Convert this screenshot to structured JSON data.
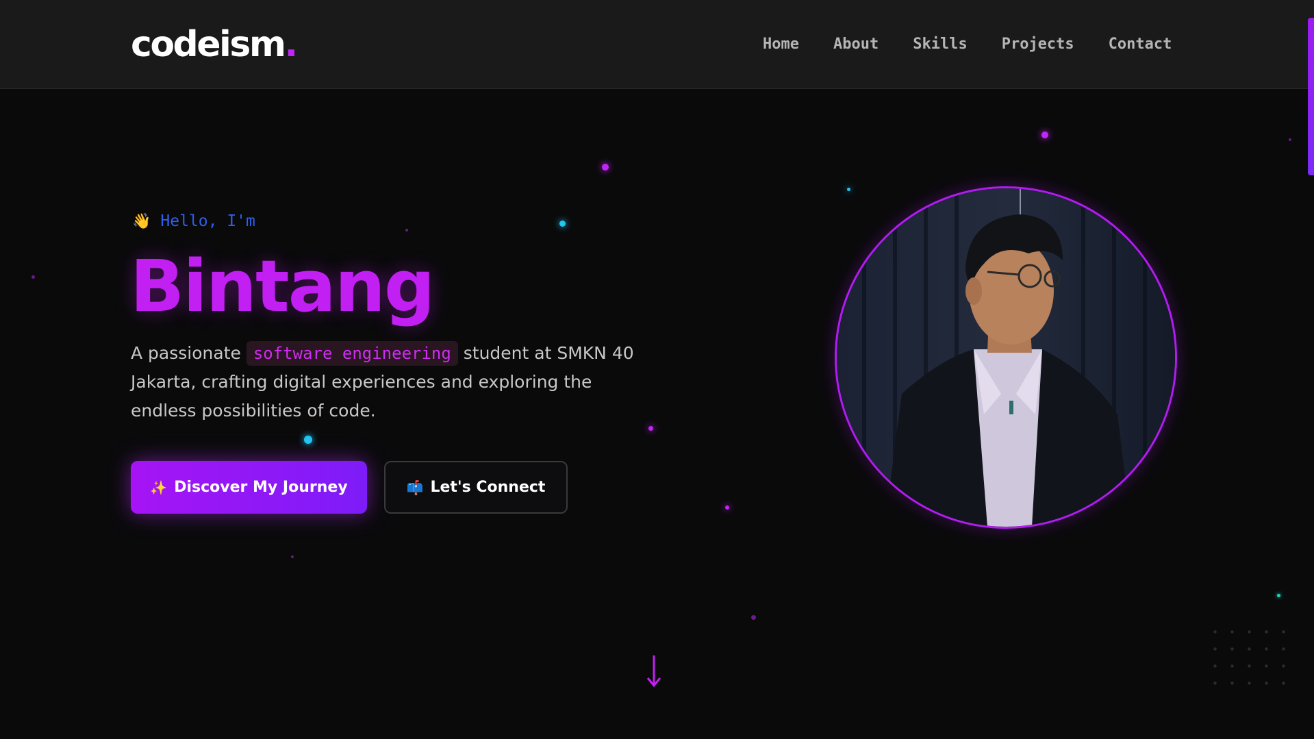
{
  "nav": {
    "logo_text": "codeism",
    "logo_dot": ".",
    "links": [
      "Home",
      "About",
      "Skills",
      "Projects",
      "Contact"
    ]
  },
  "hero": {
    "wave_icon": "👋",
    "greeting": "Hello, I'm",
    "name": "Bintang",
    "desc_before": "A passionate ",
    "desc_highlight": "software engineering",
    "desc_after": " student at SMKN 40 Jakarta, crafting digital experiences and exploring the endless possibilities of code.",
    "primary_button": {
      "icon": "✨",
      "label": "Discover My Journey"
    },
    "secondary_button": {
      "icon": "📫",
      "label": "Let's Connect"
    }
  },
  "icons": {
    "wave": "waving-hand-icon",
    "sparkles": "sparkles-icon",
    "mailbox": "mailbox-icon",
    "scroll": "arrow-down-icon",
    "avatar": "profile-photo"
  },
  "colors": {
    "accent": "#c21ff2",
    "accent_secondary": "#7d1cf8",
    "greeting": "#2f5ff0",
    "background": "#0a0a0b",
    "navbar": "#1a1a1b",
    "cyan_particle": "#22c6f2"
  }
}
